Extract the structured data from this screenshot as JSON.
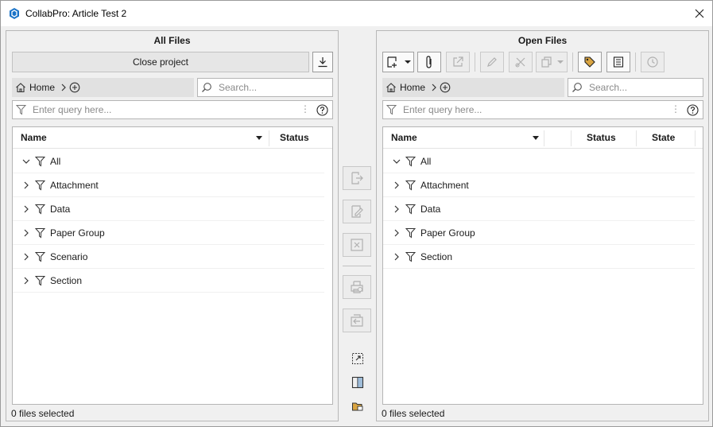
{
  "window": {
    "title": "CollabPro: Article Test 2"
  },
  "left": {
    "title": "All Files",
    "close_project_label": "Close project",
    "breadcrumb_home": "Home",
    "search_placeholder": "Search...",
    "query_placeholder": "Enter query here...",
    "columns": [
      "Name",
      "Status"
    ],
    "items": [
      {
        "label": "All",
        "expanded": true
      },
      {
        "label": "Attachment",
        "expanded": false
      },
      {
        "label": "Data",
        "expanded": false
      },
      {
        "label": "Paper Group",
        "expanded": false
      },
      {
        "label": "Scenario",
        "expanded": false
      },
      {
        "label": "Section",
        "expanded": false
      }
    ],
    "status_text": "0 files selected"
  },
  "right": {
    "title": "Open Files",
    "breadcrumb_home": "Home",
    "search_placeholder": "Search...",
    "query_placeholder": "Enter query here...",
    "columns": [
      "Name",
      "Status",
      "State"
    ],
    "items": [
      {
        "label": "All",
        "expanded": true
      },
      {
        "label": "Attachment",
        "expanded": false
      },
      {
        "label": "Data",
        "expanded": false
      },
      {
        "label": "Paper Group",
        "expanded": false
      },
      {
        "label": "Section",
        "expanded": false
      }
    ],
    "status_text": "0 files selected"
  },
  "icons": {
    "app": "collabpro-logo-icon",
    "close": "close-icon",
    "download": "download-icon",
    "home": "home-icon",
    "add": "add-circle-icon",
    "search": "search-icon",
    "filter": "filter-icon",
    "help": "help-icon"
  },
  "colors": {
    "accent": "#1a73c8",
    "disabled": "#b0b0b0",
    "tag": "#d9a441"
  }
}
